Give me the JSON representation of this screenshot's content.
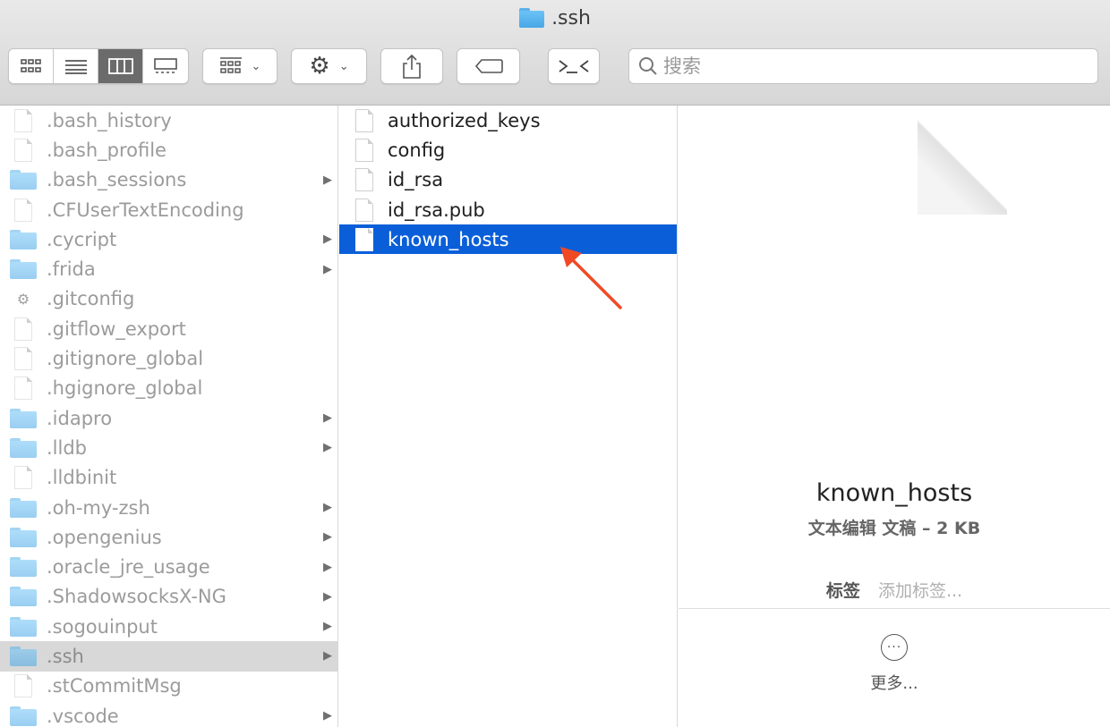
{
  "window": {
    "title": ".ssh"
  },
  "toolbar": {
    "view_buttons": [
      "icon-view",
      "list-view",
      "column-view",
      "gallery-view"
    ],
    "active_view": "column-view",
    "search_placeholder": "搜索"
  },
  "column1": {
    "items": [
      {
        "name": ".bash_history",
        "type": "file"
      },
      {
        "name": ".bash_profile",
        "type": "file"
      },
      {
        "name": ".bash_sessions",
        "type": "folder"
      },
      {
        "name": ".CFUserTextEncoding",
        "type": "file"
      },
      {
        "name": ".cycript",
        "type": "folder"
      },
      {
        "name": ".frida",
        "type": "folder"
      },
      {
        "name": ".gitconfig",
        "type": "gear"
      },
      {
        "name": ".gitflow_export",
        "type": "file"
      },
      {
        "name": ".gitignore_global",
        "type": "file"
      },
      {
        "name": ".hgignore_global",
        "type": "file"
      },
      {
        "name": ".idapro",
        "type": "folder"
      },
      {
        "name": ".lldb",
        "type": "folder"
      },
      {
        "name": ".lldbinit",
        "type": "file"
      },
      {
        "name": ".oh-my-zsh",
        "type": "folder"
      },
      {
        "name": ".opengenius",
        "type": "folder"
      },
      {
        "name": ".oracle_jre_usage",
        "type": "folder"
      },
      {
        "name": ".ShadowsocksX-NG",
        "type": "folder"
      },
      {
        "name": ".sogouinput",
        "type": "folder"
      },
      {
        "name": ".ssh",
        "type": "folder"
      },
      {
        "name": ".stCommitMsg",
        "type": "file"
      },
      {
        "name": ".vscode",
        "type": "folder"
      }
    ]
  },
  "column2": {
    "items": [
      "authorized_keys",
      "config",
      "id_rsa",
      "id_rsa.pub",
      "known_hosts"
    ],
    "selected": "known_hosts"
  },
  "preview": {
    "name": "known_hosts",
    "kind": "文本编辑 文稿 – 2 KB",
    "tags_label": "标签",
    "tags_placeholder": "添加标签...",
    "more_label": "更多..."
  },
  "colors": {
    "selection": "#0a5fd9",
    "annotation_arrow": "#f04a24"
  }
}
